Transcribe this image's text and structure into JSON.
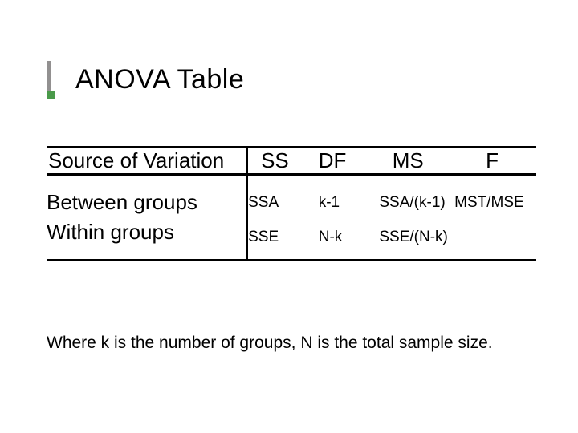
{
  "title": "ANOVA Table",
  "table": {
    "headers": {
      "c1": "Source of Variation",
      "c2": "SS",
      "c3": "DF",
      "c4": "MS",
      "c5": "F"
    },
    "rows": [
      {
        "label": "Between groups",
        "ss": "SSA",
        "df": "k-1",
        "ms": "SSA/(k-1)",
        "f": "MST/MSE"
      },
      {
        "label": "Within groups",
        "ss": "SSE",
        "df": "N-k",
        "ms": "SSE/(N-k)",
        "f": ""
      }
    ]
  },
  "footnote": "Where k is the number of groups, N is the total sample size."
}
